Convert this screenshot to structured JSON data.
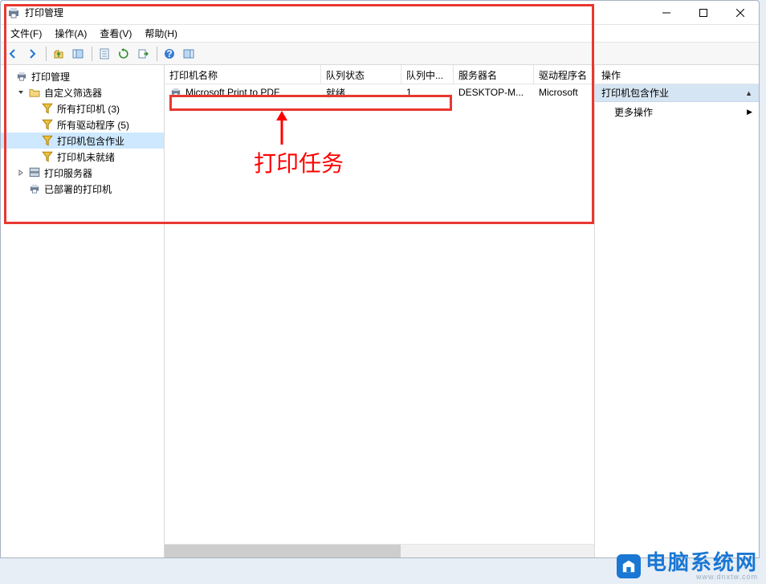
{
  "window": {
    "title": "打印管理"
  },
  "titlebar": {
    "min": "Minimize",
    "max": "Maximize",
    "close": "Close"
  },
  "menus": {
    "file": "文件(F)",
    "action": "操作(A)",
    "view": "查看(V)",
    "help": "帮助(H)"
  },
  "toolbar": {
    "back": "back",
    "fwd": "forward",
    "up": "up",
    "props": "properties",
    "refresh": "refresh",
    "export": "export",
    "help": "help",
    "showactions": "show-actions"
  },
  "tree": {
    "root": "打印管理",
    "custom": "自定义筛选器",
    "allPrinters": "所有打印机 (3)",
    "allDrivers": "所有驱动程序 (5)",
    "withJobs": "打印机包含作业",
    "notReady": "打印机未就绪",
    "servers": "打印服务器",
    "deployed": "已部署的打印机"
  },
  "columns": {
    "name": "打印机名称",
    "status": "队列状态",
    "jobs": "队列中...",
    "server": "服务器名",
    "driver": "驱动程序名"
  },
  "row": {
    "name": "Microsoft Print to PDF",
    "status": "就绪",
    "jobs": "1",
    "server": "DESKTOP-M...",
    "driver": "Microsoft"
  },
  "actions": {
    "title": "操作",
    "subtitle": "打印机包含作业",
    "more": "更多操作"
  },
  "annotation": {
    "label": "打印任务"
  },
  "watermark": {
    "text": "电脑系统网",
    "sub": "www.dnxtw.com"
  }
}
